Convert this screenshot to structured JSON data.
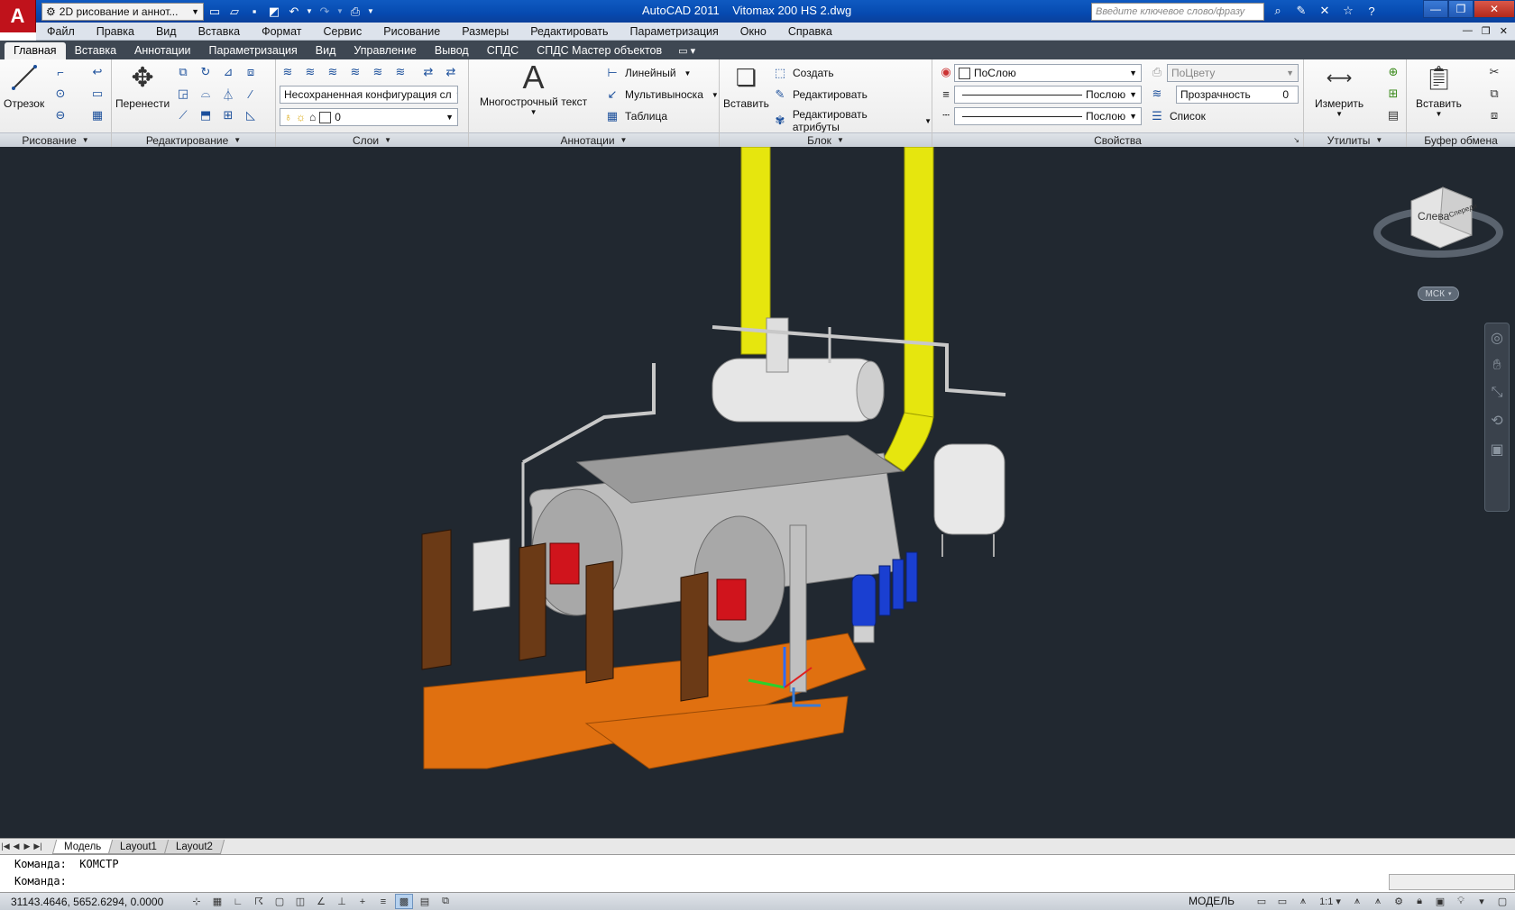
{
  "app": {
    "title": "AutoCAD 2011    Vitomax 200 HS 2.dwg",
    "logo_letter": "A",
    "workspace": "2D рисование и аннот...",
    "search_placeholder": "Введите ключевое слово/фразу"
  },
  "menu": [
    "Файл",
    "Правка",
    "Вид",
    "Вставка",
    "Формат",
    "Сервис",
    "Рисование",
    "Размеры",
    "Редактировать",
    "Параметризация",
    "Окно",
    "Справка"
  ],
  "ribbon_tabs": [
    "Главная",
    "Вставка",
    "Аннотации",
    "Параметризация",
    "Вид",
    "Управление",
    "Вывод",
    "СПДС",
    "СПДС Мастер объектов"
  ],
  "ribbon_tab_extra": "▭ ▾",
  "panels": {
    "draw": {
      "label": "Рисование",
      "line_btn": "Отрезок"
    },
    "modify": {
      "label": "Редактирование",
      "move_btn": "Перенести"
    },
    "layers": {
      "label": "Слои",
      "layer_state": "Несохраненная конфигурация сл",
      "current_layer": "0"
    },
    "annotation": {
      "label": "Аннотации",
      "mtext_btn": "Многострочный текст",
      "linear": "Линейный",
      "multileader": "Мультивыноска",
      "table": "Таблица"
    },
    "block": {
      "label": "Блок",
      "insert_btn": "Вставить",
      "create": "Создать",
      "edit": "Редактировать",
      "edit_attr": "Редактировать атрибуты"
    },
    "properties": {
      "label": "Свойства",
      "color": "ПоСлою",
      "plot_style": "ПоЦвету",
      "linetype": "Послою",
      "lineweight": "Послою",
      "transparency_label": "Прозрачность",
      "transparency_value": "0",
      "list": "Список"
    },
    "utilities": {
      "label": "Утилиты",
      "measure_btn": "Измерить"
    },
    "clipboard": {
      "label": "Буфер обмена",
      "paste_btn": "Вставить"
    }
  },
  "viewport": {
    "viewcube_face": "Слева",
    "viewcube_face2": "Спереди",
    "wcs": "МСК"
  },
  "layout_tabs": [
    "Модель",
    "Layout1",
    "Layout2"
  ],
  "command": {
    "history": "Команда:  КОМСТР",
    "prompt": "Команда:"
  },
  "status": {
    "coords": "31143.4646, 5652.6294, 0.0000",
    "model": "МОДЕЛЬ",
    "scale": "1:1 ▾"
  },
  "colors": {
    "viewport_bg": "#212830",
    "pipe_yellow": "#e6e60e",
    "floor_orange": "#e07010",
    "burner_red": "#d0141c",
    "door_brown": "#6b3a16",
    "boiler_gray": "#bdbdbd"
  }
}
